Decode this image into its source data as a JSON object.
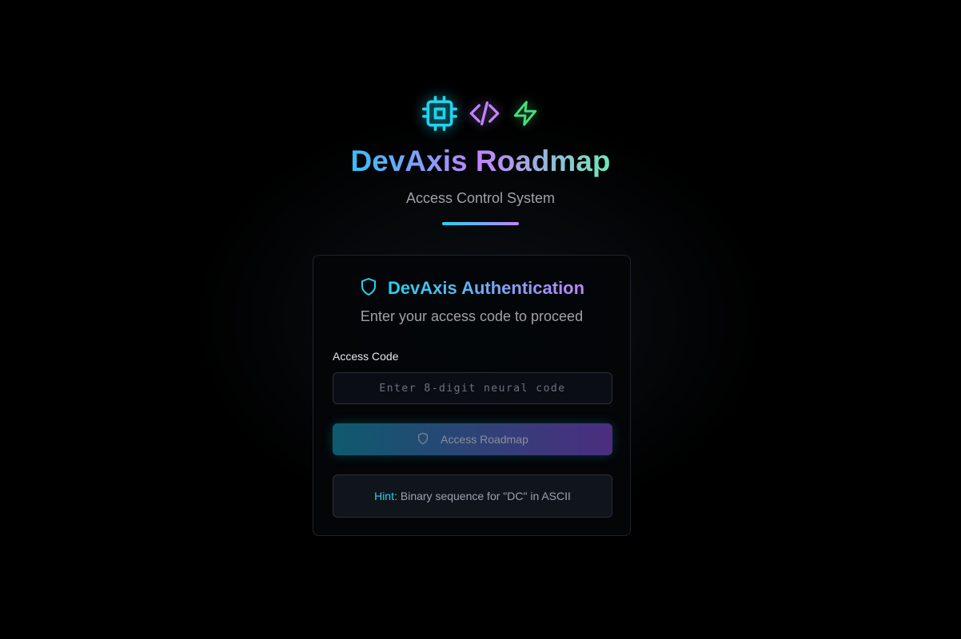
{
  "brand": {
    "icons": [
      "cpu-icon",
      "code-icon",
      "zap-icon"
    ],
    "title": "DevAxis Roadmap",
    "subtitle": "Access Control System"
  },
  "auth": {
    "icon": "shield-icon",
    "title": "DevAxis Authentication",
    "subtitle": "Enter your access code to proceed",
    "field_label": "Access Code",
    "input_value": "",
    "input_placeholder": "Enter 8-digit neural code",
    "button_label": "Access Roadmap",
    "button_icon": "shield-icon",
    "hint_label": "Hint:",
    "hint_text": "Binary sequence for \"DC\" in ASCII"
  },
  "colors": {
    "background": "#000000",
    "accent_cyan": "#22d3ee",
    "accent_purple": "#c084fc",
    "accent_green": "#4ade80"
  }
}
